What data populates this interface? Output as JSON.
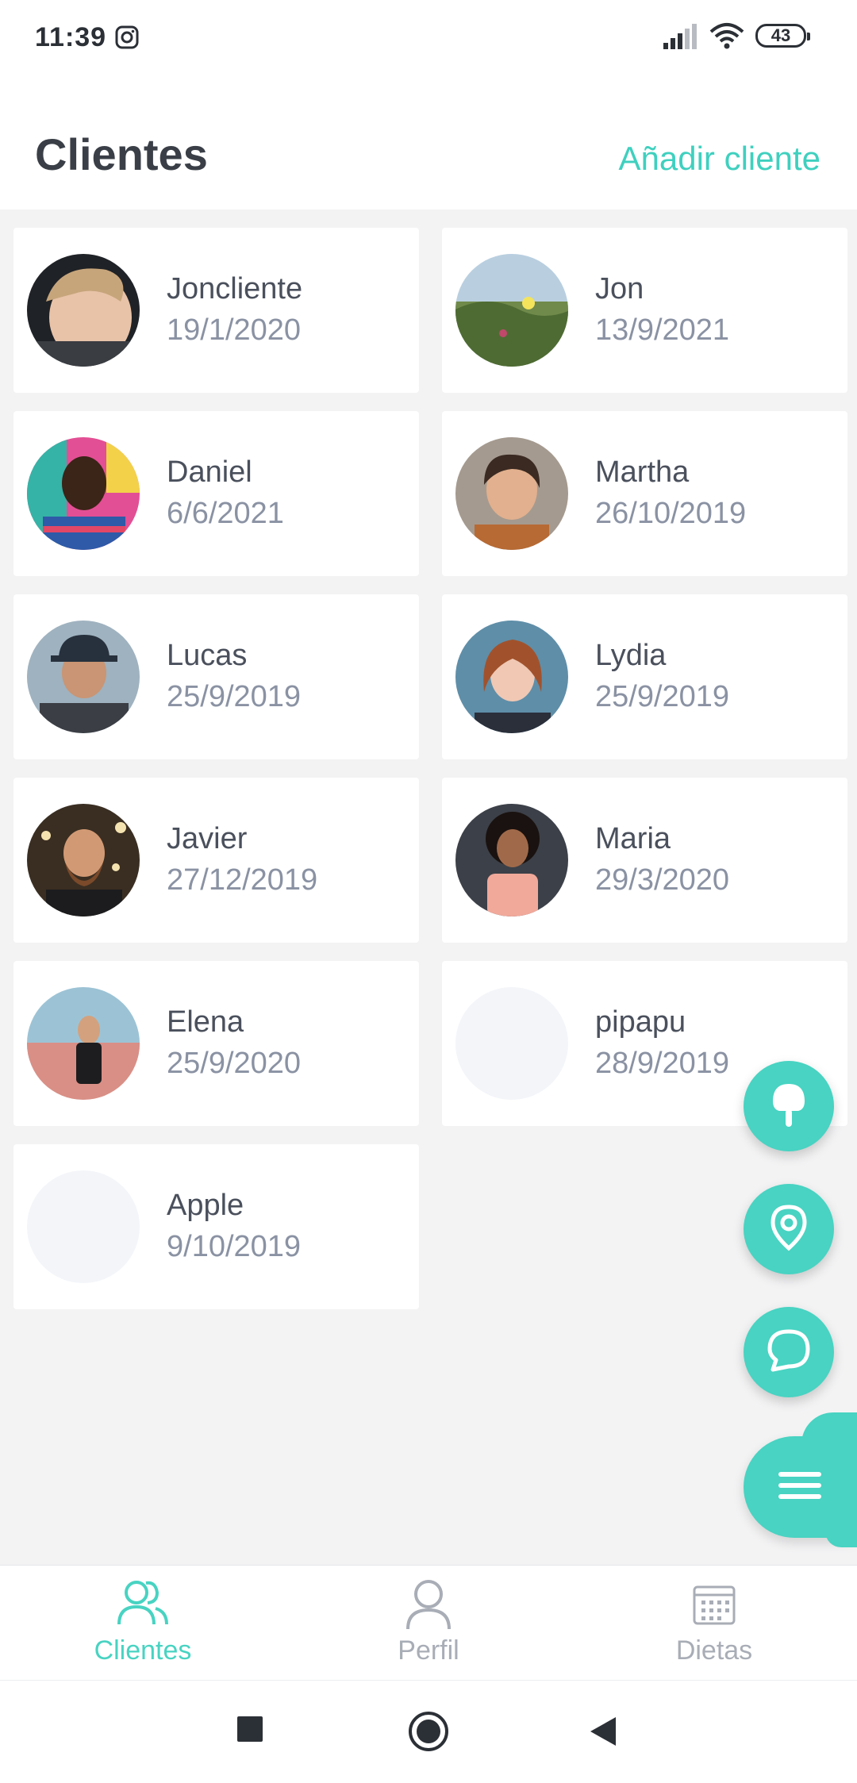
{
  "status_bar": {
    "time": "11:39",
    "battery": "43"
  },
  "header": {
    "title": "Clientes",
    "add_label": "Añadir cliente"
  },
  "clients": [
    {
      "name": "Joncliente",
      "date": "19/1/2020"
    },
    {
      "name": "Jon",
      "date": "13/9/2021"
    },
    {
      "name": "Daniel",
      "date": "6/6/2021"
    },
    {
      "name": "Martha",
      "date": "26/10/2019"
    },
    {
      "name": "Lucas",
      "date": "25/9/2019"
    },
    {
      "name": "Lydia",
      "date": "25/9/2019"
    },
    {
      "name": "Javier",
      "date": "27/12/2019"
    },
    {
      "name": "Maria",
      "date": "29/3/2020"
    },
    {
      "name": "Elena",
      "date": "25/9/2020"
    },
    {
      "name": "pipapu",
      "date": "28/9/2019"
    },
    {
      "name": "Apple",
      "date": "9/10/2019"
    }
  ],
  "nav": {
    "items": [
      {
        "label": "Clientes",
        "icon": "users-icon",
        "active": true
      },
      {
        "label": "Perfil",
        "icon": "user-icon",
        "active": false
      },
      {
        "label": "Dietas",
        "icon": "calendar-icon",
        "active": false
      }
    ]
  },
  "fabs": [
    "ice-cream-icon",
    "location-pin-icon",
    "chat-bubble-icon",
    "menu-icon"
  ],
  "colors": {
    "accent": "#48d3c2",
    "background": "#f3f3f4",
    "card": "#ffffff",
    "text": "#454b57",
    "muted": "#8a92a3"
  }
}
